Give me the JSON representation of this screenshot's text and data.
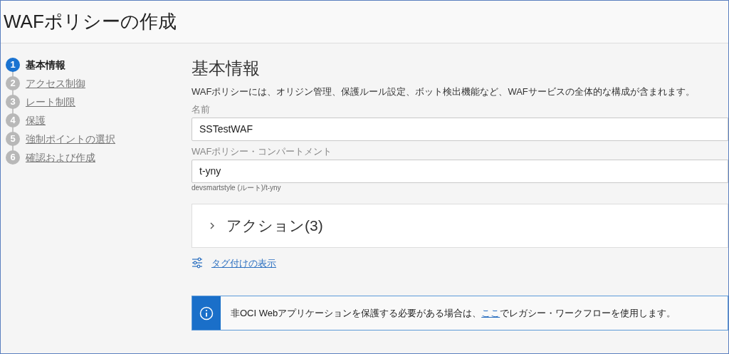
{
  "window": {
    "title": "WAFポリシーの作成"
  },
  "steps": [
    {
      "number": "1",
      "label": "基本情報",
      "selected": true
    },
    {
      "number": "2",
      "label": "アクセス制御",
      "selected": false
    },
    {
      "number": "3",
      "label": "レート制限",
      "selected": false
    },
    {
      "number": "4",
      "label": "保護",
      "selected": false
    },
    {
      "number": "5",
      "label": "強制ポイントの選択",
      "selected": false
    },
    {
      "number": "6",
      "label": "確認および作成",
      "selected": false
    }
  ],
  "section": {
    "heading": "基本情報",
    "description": "WAFポリシーには、オリジン管理、保護ルール設定、ボット検出機能など、WAFサービスの全体的な構成が含まれます。"
  },
  "fields": [
    {
      "label": "名前",
      "value": "SSTestWAF"
    },
    {
      "label": "WAFポリシー・コンパートメント",
      "value": "t-yny",
      "hint": "devsmartstyle (ルート)/t-yny"
    }
  ],
  "actions": {
    "label": "アクション(3)",
    "expanded": false
  },
  "tags_link": "タグ付けの表示",
  "info": {
    "before": "非OCI Webアプリケーションを保護する必要がある場合は、",
    "link": "ここ",
    "after": "でレガシー・ワークフローを使用します。"
  }
}
